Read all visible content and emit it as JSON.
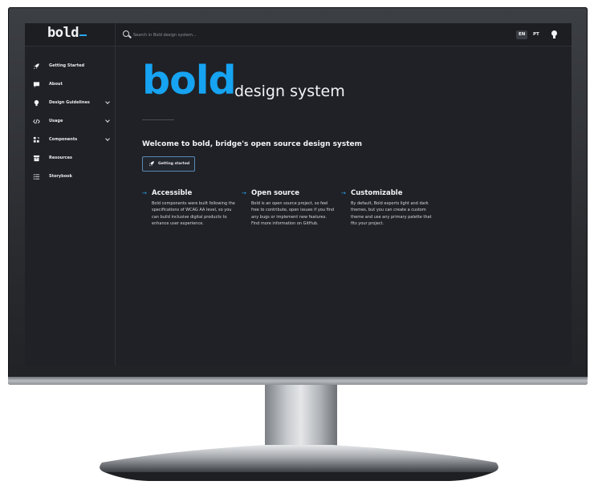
{
  "app": {
    "logo_text": "bold",
    "accent_color": "#16a3f2"
  },
  "topbar": {
    "search_placeholder": "Search in Bold design system...",
    "languages": [
      "EN",
      "PT"
    ],
    "active_language": "EN",
    "theme_icon": "lightbulb-icon"
  },
  "sidebar": {
    "items": [
      {
        "label": "Getting Started",
        "icon": "rocket-icon",
        "expandable": false
      },
      {
        "label": "About",
        "icon": "chat-icon",
        "expandable": false
      },
      {
        "label": "Design Guidelines",
        "icon": "lightbulb-icon",
        "expandable": true
      },
      {
        "label": "Usage",
        "icon": "code-icon",
        "expandable": true
      },
      {
        "label": "Components",
        "icon": "components-icon",
        "expandable": true
      },
      {
        "label": "Resources",
        "icon": "archive-icon",
        "expandable": false
      },
      {
        "label": "Storybook",
        "icon": "list-icon",
        "expandable": false
      }
    ]
  },
  "hero": {
    "title_bold": "bold",
    "title_rest": "design system",
    "welcome": "Welcome to bold, bridge's open source design system",
    "cta_label": "Getting started",
    "cta_icon": "rocket-icon"
  },
  "features": [
    {
      "title": "Accessible",
      "text": "Bold components were built following the specifications of WCAG AA level, so you can build inclusive digital products to enhance user experience."
    },
    {
      "title": "Open source",
      "text": "Bold is an open source project, so feel free to contribute, open issues if you find any bugs or implement new features. Find more information on GitHub."
    },
    {
      "title": "Customizable",
      "text": "By default, Bold exports light and dark themes, but you can create a custom theme and use any primary palette that fits your project."
    }
  ]
}
